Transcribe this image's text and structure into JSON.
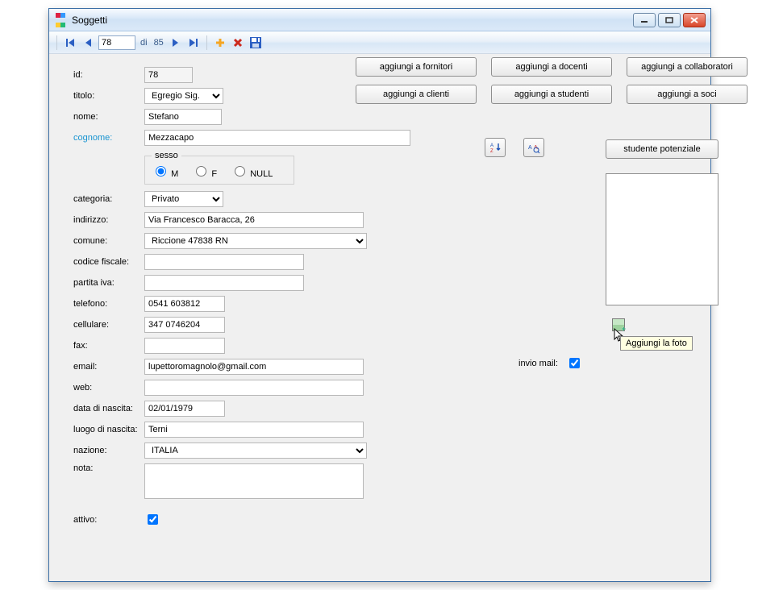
{
  "window": {
    "title": "Soggetti"
  },
  "nav": {
    "current": "78",
    "total_prefix": "di",
    "total": "85"
  },
  "actions": {
    "fornitori": "aggiungi a fornitori",
    "docenti": "aggiungi a docenti",
    "collaboratori": "aggiungi a collaboratori",
    "clienti": "aggiungi a clienti",
    "studenti": "aggiungi a studenti",
    "soci": "aggiungi a soci",
    "studente_potenziale": "studente potenziale"
  },
  "labels": {
    "id": "id:",
    "titolo": "titolo:",
    "nome": "nome:",
    "cognome": "cognome:",
    "sesso": "sesso",
    "m": "M",
    "f": "F",
    "null": "NULL",
    "categoria": "categoria:",
    "indirizzo": "indirizzo:",
    "comune": "comune:",
    "codice_fiscale": "codice fiscale:",
    "partita_iva": "partita iva:",
    "telefono": "telefono:",
    "cellulare": "cellulare:",
    "fax": "fax:",
    "email": "email:",
    "web": "web:",
    "data_nascita": "data di nascita:",
    "luogo_nascita": "luogo di nascita:",
    "nazione": "nazione:",
    "nota": "nota:",
    "attivo": "attivo:",
    "invio_mail": "invio mail:"
  },
  "values": {
    "id": "78",
    "titolo": "Egregio Sig.",
    "nome": "Stefano",
    "cognome": "Mezzacapo",
    "sesso": "M",
    "categoria": "Privato",
    "indirizzo": "Via Francesco Baracca, 26",
    "comune": "Riccione 47838 RN",
    "codice_fiscale": "",
    "partita_iva": "",
    "telefono": "0541 603812",
    "cellulare": "347 0746204",
    "fax": "",
    "email": "lupettoromagnolo@gmail.com",
    "web": "",
    "data_nascita": "02/01/1979",
    "luogo_nascita": "Terni",
    "nazione": "ITALIA",
    "nota": "",
    "attivo": true,
    "invio_mail": true
  },
  "tooltip": {
    "add_photo": "Aggiungi la foto"
  }
}
